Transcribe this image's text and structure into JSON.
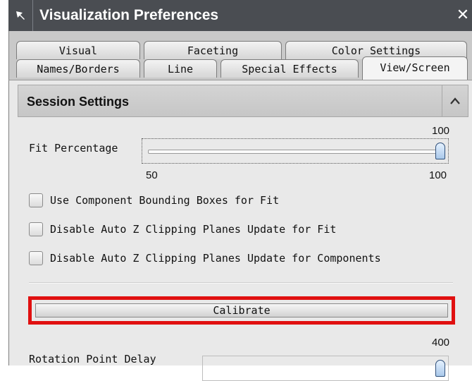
{
  "window": {
    "title": "Visualization Preferences",
    "pin_icon": "pin-icon",
    "close_icon": "close-icon"
  },
  "tabs": {
    "row_back": [
      "Visual",
      "Faceting",
      "Color Settings"
    ],
    "row_front": [
      "Names/Borders",
      "Line",
      "Special Effects",
      "View/Screen"
    ],
    "active": "View/Screen"
  },
  "section": {
    "title": "Session Settings",
    "collapse_icon": "chevron-up-icon"
  },
  "fit_percentage": {
    "label": "Fit Percentage",
    "value": "100",
    "min": "50",
    "max": "100"
  },
  "checkboxes": [
    {
      "label": "Use Component Bounding Boxes for Fit",
      "checked": false
    },
    {
      "label": "Disable Auto Z Clipping Planes Update for Fit",
      "checked": false
    },
    {
      "label": "Disable Auto Z Clipping Planes Update for Components",
      "checked": false
    }
  ],
  "calibrate": {
    "label": "Calibrate",
    "highlight_color": "#e01010"
  },
  "rotation_point_delay": {
    "label": "Rotation Point Delay",
    "value": "400"
  },
  "colors": {
    "titlebar": "#4a4d52",
    "panel": "#e9e9e9",
    "highlight": "#e01010"
  }
}
